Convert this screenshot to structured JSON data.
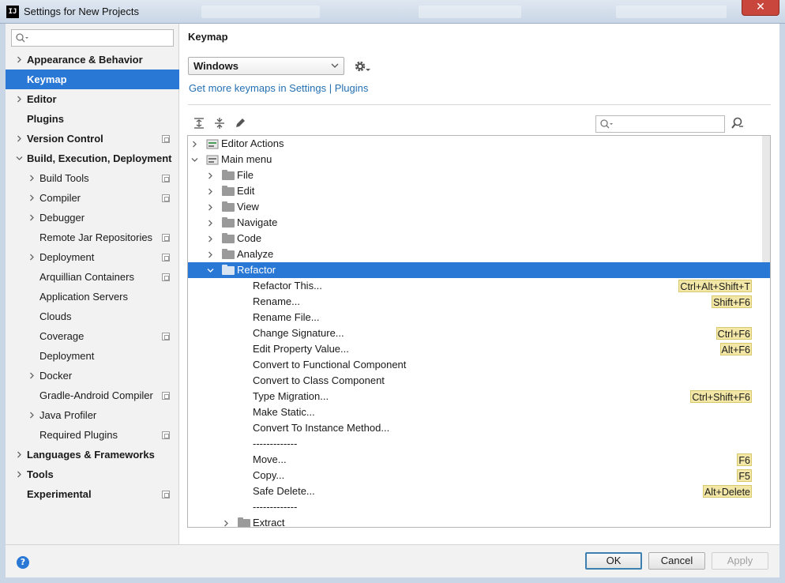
{
  "window": {
    "title": "Settings for New Projects",
    "app_icon_text": "IJ",
    "close_glyph": "✕"
  },
  "sidebar": {
    "search_placeholder": "",
    "items": [
      {
        "label": "Appearance & Behavior",
        "bold": true,
        "arrow": "right",
        "project": false
      },
      {
        "label": "Keymap",
        "bold": true,
        "arrow": "none",
        "project": false,
        "selected": true
      },
      {
        "label": "Editor",
        "bold": true,
        "arrow": "right",
        "project": false
      },
      {
        "label": "Plugins",
        "bold": true,
        "arrow": "none",
        "project": false
      },
      {
        "label": "Version Control",
        "bold": true,
        "arrow": "right",
        "project": true
      },
      {
        "label": "Build, Execution, Deployment",
        "bold": true,
        "arrow": "down",
        "project": false
      },
      {
        "label": "Build Tools",
        "bold": false,
        "arrow": "right",
        "project": true
      },
      {
        "label": "Compiler",
        "bold": false,
        "arrow": "right",
        "project": true
      },
      {
        "label": "Debugger",
        "bold": false,
        "arrow": "right",
        "project": false
      },
      {
        "label": "Remote Jar Repositories",
        "bold": false,
        "arrow": "none",
        "project": true
      },
      {
        "label": "Deployment",
        "bold": false,
        "arrow": "right",
        "project": true
      },
      {
        "label": "Arquillian Containers",
        "bold": false,
        "arrow": "none",
        "project": true
      },
      {
        "label": "Application Servers",
        "bold": false,
        "arrow": "none",
        "project": false
      },
      {
        "label": "Clouds",
        "bold": false,
        "arrow": "none",
        "project": false
      },
      {
        "label": "Coverage",
        "bold": false,
        "arrow": "none",
        "project": true
      },
      {
        "label": "Deployment",
        "bold": false,
        "arrow": "none",
        "project": false
      },
      {
        "label": "Docker",
        "bold": false,
        "arrow": "right",
        "project": false
      },
      {
        "label": "Gradle-Android Compiler",
        "bold": false,
        "arrow": "none",
        "project": true
      },
      {
        "label": "Java Profiler",
        "bold": false,
        "arrow": "right",
        "project": false
      },
      {
        "label": "Required Plugins",
        "bold": false,
        "arrow": "none",
        "project": true
      },
      {
        "label": "Languages & Frameworks",
        "bold": true,
        "arrow": "right",
        "project": false
      },
      {
        "label": "Tools",
        "bold": true,
        "arrow": "right",
        "project": false
      },
      {
        "label": "Experimental",
        "bold": true,
        "arrow": "none",
        "project": true
      }
    ]
  },
  "main": {
    "heading": "Keymap",
    "keymap_select": "Windows",
    "more_keymaps_link": "Get more keymaps in Settings | Plugins",
    "search_placeholder": "",
    "tree": [
      {
        "text": "Editor Actions",
        "level": 0,
        "expander": "right",
        "icon": "actions-icon"
      },
      {
        "text": "Main menu",
        "level": 0,
        "expander": "down",
        "icon": "menu-icon"
      },
      {
        "text": "File",
        "level": 1,
        "expander": "right",
        "icon": "folder-icon"
      },
      {
        "text": "Edit",
        "level": 1,
        "expander": "right",
        "icon": "folder-icon"
      },
      {
        "text": "View",
        "level": 1,
        "expander": "right",
        "icon": "folder-icon"
      },
      {
        "text": "Navigate",
        "level": 1,
        "expander": "right",
        "icon": "folder-icon"
      },
      {
        "text": "Code",
        "level": 1,
        "expander": "right",
        "icon": "folder-icon"
      },
      {
        "text": "Analyze",
        "level": 1,
        "expander": "right",
        "icon": "folder-icon"
      },
      {
        "text": "Refactor",
        "level": 1,
        "expander": "down",
        "icon": "folder-icon",
        "selected": true
      },
      {
        "text": "Refactor This...",
        "level": 2,
        "shortcut": "Ctrl+Alt+Shift+T"
      },
      {
        "text": "Rename...",
        "level": 2,
        "shortcut": "Shift+F6"
      },
      {
        "text": "Rename File...",
        "level": 2
      },
      {
        "text": "Change Signature...",
        "level": 2,
        "shortcut": "Ctrl+F6"
      },
      {
        "text": "Edit Property Value...",
        "level": 2,
        "shortcut": "Alt+F6"
      },
      {
        "text": "Convert to Functional Component",
        "level": 2
      },
      {
        "text": "Convert to Class Component",
        "level": 2
      },
      {
        "text": "Type Migration...",
        "level": 2,
        "shortcut": "Ctrl+Shift+F6"
      },
      {
        "text": "Make Static...",
        "level": 2
      },
      {
        "text": "Convert To Instance Method...",
        "level": 2
      },
      {
        "text": "-------------",
        "level": 2
      },
      {
        "text": "Move...",
        "level": 2,
        "shortcut": "F6"
      },
      {
        "text": "Copy...",
        "level": 2,
        "shortcut": "F5"
      },
      {
        "text": "Safe Delete...",
        "level": 2,
        "shortcut": "Alt+Delete"
      },
      {
        "text": "-------------",
        "level": 2
      },
      {
        "text": "Extract",
        "level": 2,
        "expander": "right",
        "icon": "folder-icon"
      }
    ]
  },
  "buttons": {
    "help": "?",
    "ok": "OK",
    "cancel": "Cancel",
    "apply": "Apply"
  },
  "colors": {
    "selection": "#2a78d6",
    "shortcut_bg": "#f2e7a6",
    "link": "#2470b3"
  }
}
